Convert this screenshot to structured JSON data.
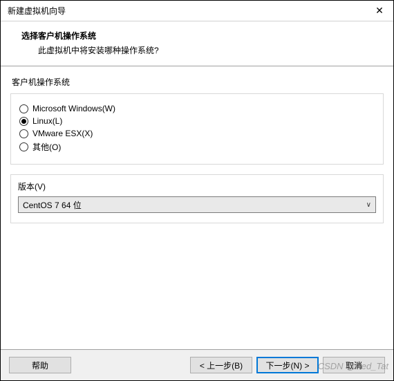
{
  "window": {
    "title": "新建虚拟机向导"
  },
  "header": {
    "heading": "选择客户机操作系统",
    "subheading": "此虚拟机中将安装哪种操作系统?"
  },
  "os_group": {
    "label": "客户机操作系统",
    "options": [
      {
        "label": "Microsoft Windows(W)",
        "selected": false
      },
      {
        "label": "Linux(L)",
        "selected": true
      },
      {
        "label": "VMware ESX(X)",
        "selected": false
      },
      {
        "label": "其他(O)",
        "selected": false
      }
    ]
  },
  "version": {
    "label": "版本(V)",
    "selected": "CentOS 7 64 位"
  },
  "footer": {
    "help": "帮助",
    "back": "< 上一步(B)",
    "next": "下一步(N) >",
    "cancel": "取消"
  },
  "watermark": "CSDN @Red_Tat"
}
